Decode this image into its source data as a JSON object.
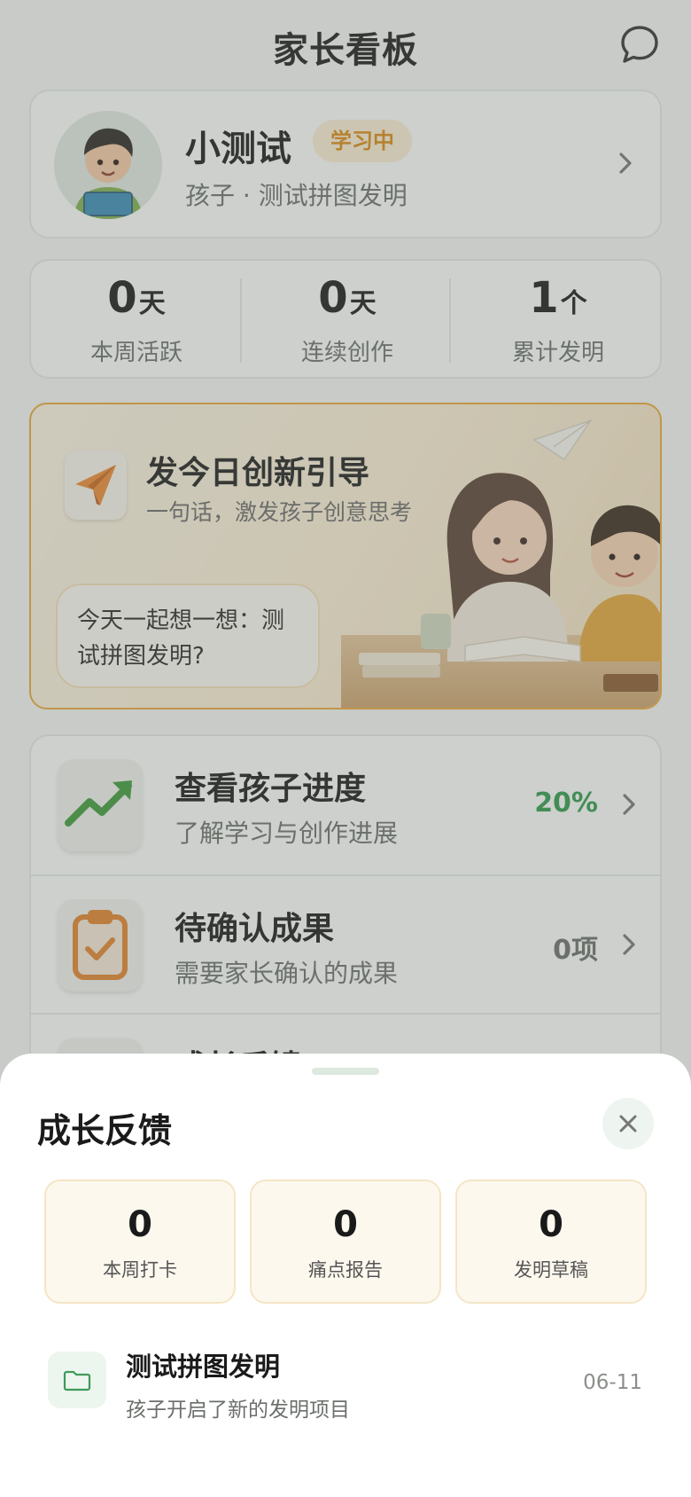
{
  "header": {
    "title": "家长看板",
    "chat_icon": "chat-bubble-icon"
  },
  "profile": {
    "name": "小测试",
    "status": "学习中",
    "subtitle": "孩子 · 测试拼图发明"
  },
  "stats": [
    {
      "value": "0",
      "unit": "天",
      "label": "本周活跃"
    },
    {
      "value": "0",
      "unit": "天",
      "label": "连续创作"
    },
    {
      "value": "1",
      "unit": "个",
      "label": "累计发明"
    }
  ],
  "guide": {
    "title": "发今日创新引导",
    "subtitle": "一句话，激发孩子创意思考",
    "bubble": "今天一起想一想：测试拼图发明?"
  },
  "menu": [
    {
      "title": "查看孩子进度",
      "subtitle": "了解学习与创作进展",
      "value": "20%",
      "value_color": "#2e9a4a",
      "icon": "trend-up-icon"
    },
    {
      "title": "待确认成果",
      "subtitle": "需要家长确认的成果",
      "value": "0项",
      "value_color": "#6b6f6b",
      "icon": "clipboard-check-icon"
    },
    {
      "title": "成长反馈",
      "subtitle": "",
      "value": "",
      "icon": "feedback-icon"
    }
  ],
  "sheet": {
    "title": "成长反馈",
    "stats": [
      {
        "value": "0",
        "label": "本周打卡"
      },
      {
        "value": "0",
        "label": "痛点报告"
      },
      {
        "value": "0",
        "label": "发明草稿"
      }
    ],
    "activity": {
      "title": "测试拼图发明",
      "subtitle": "孩子开启了新的发明项目",
      "date": "06-11",
      "icon": "folder-icon"
    }
  },
  "colors": {
    "accent_green": "#2e9a4a",
    "accent_orange": "#e9a73a",
    "badge_text": "#d98a14"
  }
}
